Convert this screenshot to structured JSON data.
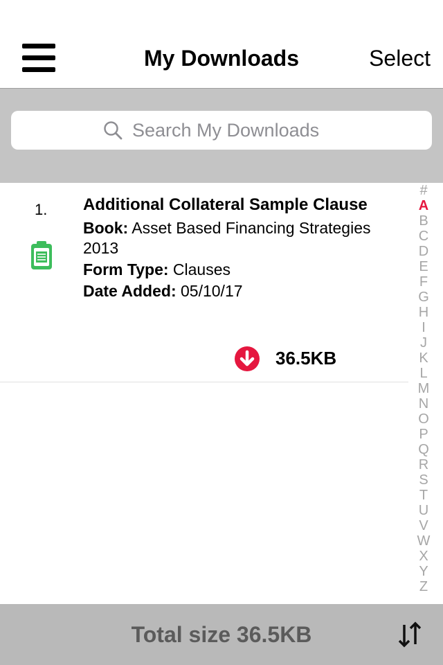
{
  "header": {
    "title": "My Downloads",
    "select_label": "Select"
  },
  "search": {
    "placeholder": "Search My Downloads"
  },
  "downloads": [
    {
      "number": "1.",
      "title": "Additional Collateral Sample Clause",
      "book_label": "Book:",
      "book_value": "Asset Based Financing Strategies 2013",
      "form_type_label": "Form Type:",
      "form_type_value": "Clauses",
      "date_label": "Date Added:",
      "date_value": "05/10/17",
      "size": "36.5KB",
      "icon": "clipboard-document-icon",
      "action_icon": "download-arrow-icon"
    }
  ],
  "index_bar": {
    "letters": [
      "#",
      "A",
      "B",
      "C",
      "D",
      "E",
      "F",
      "G",
      "H",
      "I",
      "J",
      "K",
      "L",
      "M",
      "N",
      "O",
      "P",
      "Q",
      "R",
      "S",
      "T",
      "U",
      "V",
      "W",
      "X",
      "Y",
      "Z"
    ],
    "active": "A"
  },
  "footer": {
    "total_size": "Total size 36.5KB",
    "sort_icon": "sort-arrows-icon"
  },
  "colors": {
    "accent_red": "#e5173f",
    "doc_green": "#3dbd5c",
    "search_band": "#c4c4c4",
    "footer_band": "#b9b9b9"
  }
}
